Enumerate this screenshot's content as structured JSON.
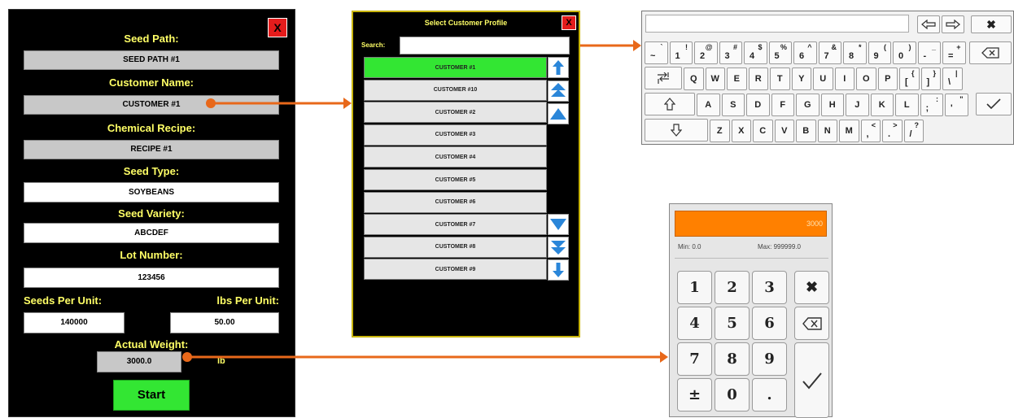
{
  "seed_panel": {
    "labels": {
      "seed_path": "Seed Path:",
      "customer_name": "Customer Name:",
      "chemical_recipe": "Chemical Recipe:",
      "seed_type": "Seed Type:",
      "seed_variety": "Seed Variety:",
      "lot_number": "Lot Number:",
      "seeds_per_unit": "Seeds Per Unit:",
      "lbs_per_unit": "lbs Per Unit:",
      "actual_weight": "Actual Weight:"
    },
    "values": {
      "seed_path": "SEED PATH #1",
      "customer_name": "CUSTOMER #1",
      "chemical_recipe": "RECIPE #1",
      "seed_type": "SOYBEANS",
      "seed_variety": "ABCDEF",
      "lot_number": "123456",
      "seeds_per_unit": "140000",
      "lbs_per_unit": "50.00",
      "actual_weight": "3000.0"
    },
    "weight_unit": "lb",
    "start_label": "Start",
    "close_label": "X"
  },
  "customer_dialog": {
    "title": "Select Customer Profile",
    "search_label": "Search:",
    "search_value": "",
    "close_label": "X",
    "items": [
      "CUSTOMER #1",
      "CUSTOMER #10",
      "CUSTOMER #2",
      "CUSTOMER #3",
      "CUSTOMER #4",
      "CUSTOMER #5",
      "CUSTOMER #6",
      "CUSTOMER #7",
      "CUSTOMER #8",
      "CUSTOMER #9"
    ]
  },
  "keyboard": {
    "input_value": "",
    "row1": [
      [
        "~",
        "`"
      ],
      [
        "1",
        "!"
      ],
      [
        "2",
        "@"
      ],
      [
        "3",
        "#"
      ],
      [
        "4",
        "$"
      ],
      [
        "5",
        "%"
      ],
      [
        "6",
        "^"
      ],
      [
        "7",
        "&"
      ],
      [
        "8",
        "*"
      ],
      [
        "9",
        "("
      ],
      [
        "0",
        ")"
      ],
      [
        "-",
        "_"
      ],
      [
        "=",
        "+"
      ]
    ],
    "row2": [
      "Q",
      "W",
      "E",
      "R",
      "T",
      "Y",
      "U",
      "I",
      "O",
      "P",
      [
        "[",
        "{"
      ],
      [
        "]",
        "}"
      ],
      [
        "\\",
        "|"
      ]
    ],
    "row3": [
      "A",
      "S",
      "D",
      "F",
      "G",
      "H",
      "J",
      "K",
      "L",
      [
        ";",
        ":"
      ],
      [
        "'",
        "\""
      ]
    ],
    "row4": [
      "Z",
      "X",
      "C",
      "V",
      "B",
      "N",
      "M",
      [
        ",",
        "<"
      ],
      [
        ".",
        ">"
      ],
      [
        "/",
        "?"
      ]
    ],
    "icons": {
      "left": "arrow-left-icon",
      "right": "arrow-right-icon",
      "close": "close-icon",
      "backspace": "backspace-icon",
      "tab": "tab-icon",
      "shift": "shift-icon",
      "caps": "caps-icon",
      "enter": "checkmark-icon"
    }
  },
  "numpad": {
    "display_value": "3000",
    "min_label": "Min:",
    "min_value": "0.0",
    "max_label": "Max:",
    "max_value": "999999.0",
    "keys": [
      "1",
      "2",
      "3",
      "4",
      "5",
      "6",
      "7",
      "8",
      "9",
      "±",
      "0",
      "."
    ],
    "accent": "#ff8000"
  },
  "colors": {
    "connector": "#e8681a",
    "panel_label": "#ffff66",
    "selected": "#33e633",
    "close": "#e51c1c",
    "arrow_blue": "#2a86d9"
  }
}
